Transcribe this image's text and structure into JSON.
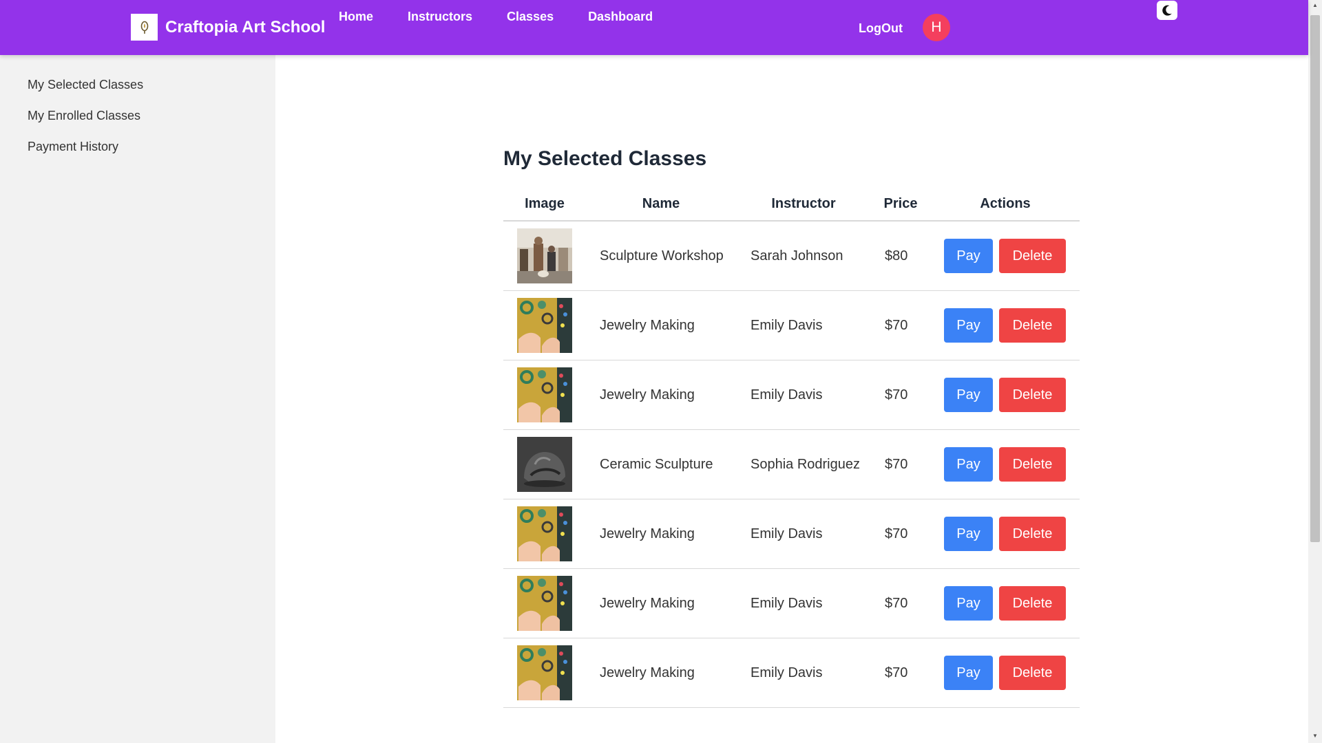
{
  "header": {
    "brand_name": "Craftopia Art School",
    "logo_icon": "paintbrush-logo",
    "nav": [
      {
        "label": "Home"
      },
      {
        "label": "Instructors"
      },
      {
        "label": "Classes"
      },
      {
        "label": "Dashboard"
      }
    ],
    "logout_label": "LogOut",
    "avatar_initial": "H",
    "theme_toggle_icon": "moon-icon",
    "accent_color": "#9333ea"
  },
  "sidebar": {
    "items": [
      {
        "label": "My Selected Classes"
      },
      {
        "label": "My Enrolled Classes"
      },
      {
        "label": "Payment History"
      }
    ]
  },
  "main": {
    "title": "My Selected Classes",
    "columns": [
      "Image",
      "Name",
      "Instructor",
      "Price",
      "Actions"
    ],
    "rows": [
      {
        "name": "Sculpture Workshop",
        "instructor": "Sarah Johnson",
        "price": "$80",
        "image": "sculpture-workshop-photo",
        "pay_label": "Pay",
        "delete_label": "Delete"
      },
      {
        "name": "Jewelry Making",
        "instructor": "Emily Davis",
        "price": "$70",
        "image": "jewelry-making-photo",
        "pay_label": "Pay",
        "delete_label": "Delete"
      },
      {
        "name": "Jewelry Making",
        "instructor": "Emily Davis",
        "price": "$70",
        "image": "jewelry-making-photo",
        "pay_label": "Pay",
        "delete_label": "Delete"
      },
      {
        "name": "Ceramic Sculpture",
        "instructor": "Sophia Rodriguez",
        "price": "$70",
        "image": "ceramic-sculpture-photo",
        "pay_label": "Pay",
        "delete_label": "Delete"
      },
      {
        "name": "Jewelry Making",
        "instructor": "Emily Davis",
        "price": "$70",
        "image": "jewelry-making-photo",
        "pay_label": "Pay",
        "delete_label": "Delete"
      },
      {
        "name": "Jewelry Making",
        "instructor": "Emily Davis",
        "price": "$70",
        "image": "jewelry-making-photo",
        "pay_label": "Pay",
        "delete_label": "Delete"
      },
      {
        "name": "Jewelry Making",
        "instructor": "Emily Davis",
        "price": "$70",
        "image": "jewelry-making-photo",
        "pay_label": "Pay",
        "delete_label": "Delete"
      }
    ],
    "pay_color": "#3b82f6",
    "delete_color": "#ef4444"
  }
}
